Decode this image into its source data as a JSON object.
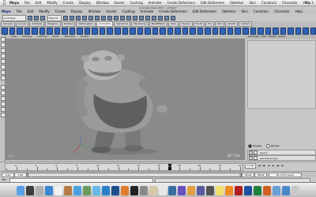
{
  "menubar": {
    "app": "Maya",
    "items": [
      "File",
      "Edit",
      "Modify",
      "Create",
      "Display",
      "Window",
      "Assets",
      "Caching",
      "Animate",
      "Create Deformers",
      "Edit Deformers",
      "Skeleton",
      "Skin",
      "Constrain",
      "Character",
      "Help"
    ],
    "clock": "Thu 1:",
    "colors": {
      "bar": "#e6e6e6"
    }
  },
  "window": {
    "title": "Autodesk Maya 2011 - untitled*"
  },
  "maya_menu": {
    "logo": "Maya",
    "items": [
      "File",
      "Edit",
      "Modify",
      "Create",
      "Display",
      "Window",
      "Assets",
      "Caching",
      "Animate",
      "Create Deformers",
      "Edit Deformers",
      "Skeleton",
      "Skin",
      "Constrain",
      "Character",
      "Help"
    ]
  },
  "status_line": {
    "menu_set": "Animation",
    "select_mode": "Objects"
  },
  "shelf": {
    "tabs": [
      "General",
      "Curves",
      "Surfaces",
      "Polygons",
      "Subdivs",
      "Deformation",
      "Animation",
      "Dynamics",
      "Rendering",
      "PaintEffects",
      "Toon",
      "Muscle",
      "Fluids",
      "Fur",
      "Hair",
      "nCloth",
      "Custom"
    ],
    "active_tab": "Animation",
    "icon_color": "#2f63b8",
    "icons": [
      "key-icon",
      "set-key-icon",
      "breakdown-icon",
      "inbetween-icon",
      "graph-editor-icon",
      "dope-sheet-icon",
      "trax-icon",
      "motion-path-icon",
      "ghost-icon",
      "unghost-icon",
      "joint-icon",
      "ik-handle-icon",
      "ik-spline-icon",
      "bind-skin-icon",
      "paint-weights-icon",
      "cluster-icon",
      "lattice-icon",
      "blend-shape-icon",
      "wire-icon",
      "wrinkle-icon",
      "sculpt-icon",
      "nonlinear-icon",
      "jiggle-icon",
      "point-constraint-icon",
      "aim-constraint-icon",
      "orient-constraint-icon",
      "parent-constraint-icon",
      "pole-vector-icon",
      "scale-constraint-icon",
      "geometry-constraint-icon",
      "normal-constraint-icon",
      "tangent-constraint-icon",
      "playblast-icon",
      "render-icon",
      "ipr-icon",
      "render-settings-icon",
      "hypershade-icon",
      "outliner-icon",
      "attribute-editor-icon",
      "channel-box-icon",
      "tool-settings-icon",
      "script-editor-icon"
    ]
  },
  "viewport": {
    "panel_menu": [
      "View",
      "Shading",
      "Lighting",
      "Show",
      "Renderer",
      "Panels"
    ],
    "fps": "45.7 fps",
    "background_color": "#8a8a8a",
    "character": "ogre-mesh",
    "axis_label": "x y z"
  },
  "right_panel": {
    "header": [
      "Channels",
      "Edit",
      "Object",
      "Show"
    ],
    "layers": {
      "mode_options": [
        "Display",
        "Render"
      ],
      "active_mode": "Display",
      "items": [
        {
          "v": "V",
          "name": "layer1"
        },
        {
          "v": "V",
          "name": "geometryLayer"
        }
      ]
    }
  },
  "timeline": {
    "tick_labels": [
      "2",
      "4",
      "6",
      "8",
      "10",
      "12",
      "14",
      "16",
      "18",
      "20",
      "22",
      "24"
    ],
    "current_frame": "17",
    "start_frame": "1.00",
    "current_frame_field": "17.00",
    "playback_buttons": [
      "|◀",
      "◀|",
      "◀",
      "▶",
      "|▶",
      "▶|"
    ]
  },
  "range": {
    "start": "1.00",
    "inner_start": "1.00",
    "inner_end": "24.00",
    "end": "48.00",
    "right_field": "No Anim Layer"
  },
  "command_line": {
    "label": "MEL"
  },
  "dock": {
    "icons": [
      {
        "name": "finder-icon",
        "color": "#5aa0e6"
      },
      {
        "name": "dashboard-icon",
        "color": "#3d3d3d"
      },
      {
        "name": "mail-icon",
        "color": "#b0b0b0"
      },
      {
        "name": "safari-icon",
        "color": "#3a86d4"
      },
      {
        "name": "ical-icon",
        "color": "#f2f2f2"
      },
      {
        "name": "address-book-icon",
        "color": "#b57a45"
      },
      {
        "name": "itunes-icon",
        "color": "#4aa0e0"
      },
      {
        "name": "iphoto-icon",
        "color": "#6b9a5c"
      },
      {
        "name": "ichat-icon",
        "color": "#68b8e8"
      },
      {
        "name": "maya-icon",
        "color": "#2c7ec7"
      },
      {
        "name": "photoshop-icon",
        "color": "#1f4e8c"
      },
      {
        "name": "firefox-icon",
        "color": "#e07a2c"
      },
      {
        "name": "terminal-icon",
        "color": "#222222"
      },
      {
        "name": "system-preferences-icon",
        "color": "#8a8a8a"
      },
      {
        "name": "preview-icon",
        "color": "#d8c8a8"
      },
      {
        "name": "textedit-icon",
        "color": "#e8e8e8"
      },
      {
        "name": "quicktime-icon",
        "color": "#3a6ea0"
      },
      {
        "name": "itunes-store-icon",
        "color": "#6a4fc0"
      },
      {
        "name": "garageband-icon",
        "color": "#e0a040"
      },
      {
        "name": "imovie-icon",
        "color": "#5a5aa0"
      },
      {
        "name": "calculator-icon",
        "color": "#555555"
      },
      {
        "name": "stickies-icon",
        "color": "#f0e070"
      },
      {
        "name": "vlc-icon",
        "color": "#f08a20"
      },
      {
        "name": "acrobat-icon",
        "color": "#b02020"
      },
      {
        "name": "word-icon",
        "color": "#2050a0"
      },
      {
        "name": "excel-icon",
        "color": "#208040"
      },
      {
        "name": "powerpoint-icon",
        "color": "#d06020"
      },
      {
        "name": "folder-icon",
        "color": "#6aa0d8"
      },
      {
        "name": "downloads-icon",
        "color": "#4a88c8"
      },
      {
        "name": "trash-icon",
        "color": "#c8c8c8"
      }
    ]
  }
}
